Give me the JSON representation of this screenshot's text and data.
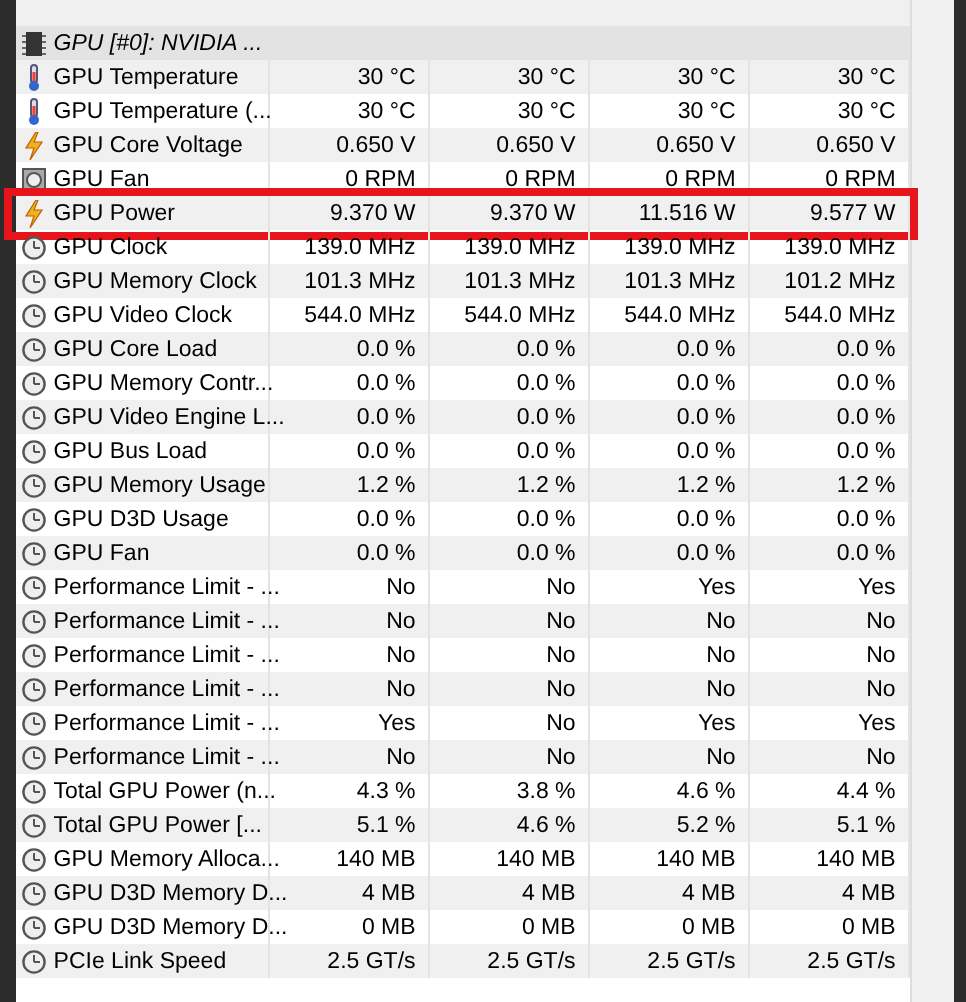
{
  "group": {
    "label": "GPU [#0]: NVIDIA ...",
    "kind": "chip"
  },
  "rows": [
    {
      "kind": "thermometer",
      "label": "GPU Temperature",
      "values": [
        "30 °C",
        "30 °C",
        "30 °C",
        "30 °C"
      ],
      "highlighted": false
    },
    {
      "kind": "thermometer",
      "label": "GPU Temperature (...",
      "values": [
        "30 °C",
        "30 °C",
        "30 °C",
        "30 °C"
      ],
      "highlighted": false
    },
    {
      "kind": "bolt",
      "label": "GPU Core Voltage",
      "values": [
        "0.650 V",
        "0.650 V",
        "0.650 V",
        "0.650 V"
      ],
      "highlighted": false
    },
    {
      "kind": "fan",
      "label": "GPU Fan",
      "values": [
        "0 RPM",
        "0 RPM",
        "0 RPM",
        "0 RPM"
      ],
      "highlighted": false
    },
    {
      "kind": "bolt",
      "label": "GPU Power",
      "values": [
        "9.370 W",
        "9.370 W",
        "11.516 W",
        "9.577 W"
      ],
      "highlighted": true
    },
    {
      "kind": "clock",
      "label": "GPU Clock",
      "values": [
        "139.0 MHz",
        "139.0 MHz",
        "139.0 MHz",
        "139.0 MHz"
      ],
      "highlighted": false
    },
    {
      "kind": "clock",
      "label": "GPU Memory Clock",
      "values": [
        "101.3 MHz",
        "101.3 MHz",
        "101.3 MHz",
        "101.2 MHz"
      ],
      "highlighted": false
    },
    {
      "kind": "clock",
      "label": "GPU Video Clock",
      "values": [
        "544.0 MHz",
        "544.0 MHz",
        "544.0 MHz",
        "544.0 MHz"
      ],
      "highlighted": false
    },
    {
      "kind": "clock",
      "label": "GPU Core Load",
      "values": [
        "0.0 %",
        "0.0 %",
        "0.0 %",
        "0.0 %"
      ],
      "highlighted": false
    },
    {
      "kind": "clock",
      "label": "GPU Memory Contr...",
      "values": [
        "0.0 %",
        "0.0 %",
        "0.0 %",
        "0.0 %"
      ],
      "highlighted": false
    },
    {
      "kind": "clock",
      "label": "GPU Video Engine L...",
      "values": [
        "0.0 %",
        "0.0 %",
        "0.0 %",
        "0.0 %"
      ],
      "highlighted": false
    },
    {
      "kind": "clock",
      "label": "GPU Bus Load",
      "values": [
        "0.0 %",
        "0.0 %",
        "0.0 %",
        "0.0 %"
      ],
      "highlighted": false
    },
    {
      "kind": "clock",
      "label": "GPU Memory Usage",
      "values": [
        "1.2 %",
        "1.2 %",
        "1.2 %",
        "1.2 %"
      ],
      "highlighted": false
    },
    {
      "kind": "clock",
      "label": "GPU D3D Usage",
      "values": [
        "0.0 %",
        "0.0 %",
        "0.0 %",
        "0.0 %"
      ],
      "highlighted": false
    },
    {
      "kind": "clock",
      "label": "GPU Fan",
      "values": [
        "0.0 %",
        "0.0 %",
        "0.0 %",
        "0.0 %"
      ],
      "highlighted": false
    },
    {
      "kind": "clock",
      "label": "Performance Limit - ...",
      "values": [
        "No",
        "No",
        "Yes",
        "Yes"
      ],
      "highlighted": false
    },
    {
      "kind": "clock",
      "label": "Performance Limit - ...",
      "values": [
        "No",
        "No",
        "No",
        "No"
      ],
      "highlighted": false
    },
    {
      "kind": "clock",
      "label": "Performance Limit - ...",
      "values": [
        "No",
        "No",
        "No",
        "No"
      ],
      "highlighted": false
    },
    {
      "kind": "clock",
      "label": "Performance Limit - ...",
      "values": [
        "No",
        "No",
        "No",
        "No"
      ],
      "highlighted": false
    },
    {
      "kind": "clock",
      "label": "Performance Limit - ...",
      "values": [
        "Yes",
        "No",
        "Yes",
        "Yes"
      ],
      "highlighted": false
    },
    {
      "kind": "clock",
      "label": "Performance Limit - ...",
      "values": [
        "No",
        "No",
        "No",
        "No"
      ],
      "highlighted": false
    },
    {
      "kind": "clock",
      "label": "Total GPU Power (n...",
      "values": [
        "4.3 %",
        "3.8 %",
        "4.6 %",
        "4.4 %"
      ],
      "highlighted": false
    },
    {
      "kind": "clock",
      "label": "Total GPU Power [...",
      "values": [
        "5.1 %",
        "4.6 %",
        "5.2 %",
        "5.1 %"
      ],
      "highlighted": false
    },
    {
      "kind": "clock",
      "label": "GPU Memory Alloca...",
      "values": [
        "140 MB",
        "140 MB",
        "140 MB",
        "140 MB"
      ],
      "highlighted": false
    },
    {
      "kind": "clock",
      "label": "GPU D3D Memory D...",
      "values": [
        "4 MB",
        "4 MB",
        "4 MB",
        "4 MB"
      ],
      "highlighted": false
    },
    {
      "kind": "clock",
      "label": "GPU D3D Memory D...",
      "values": [
        "0 MB",
        "0 MB",
        "0 MB",
        "0 MB"
      ],
      "highlighted": false
    },
    {
      "kind": "clock",
      "label": "PCIe Link Speed",
      "values": [
        "2.5 GT/s",
        "2.5 GT/s",
        "2.5 GT/s",
        "2.5 GT/s"
      ],
      "highlighted": false
    }
  ]
}
